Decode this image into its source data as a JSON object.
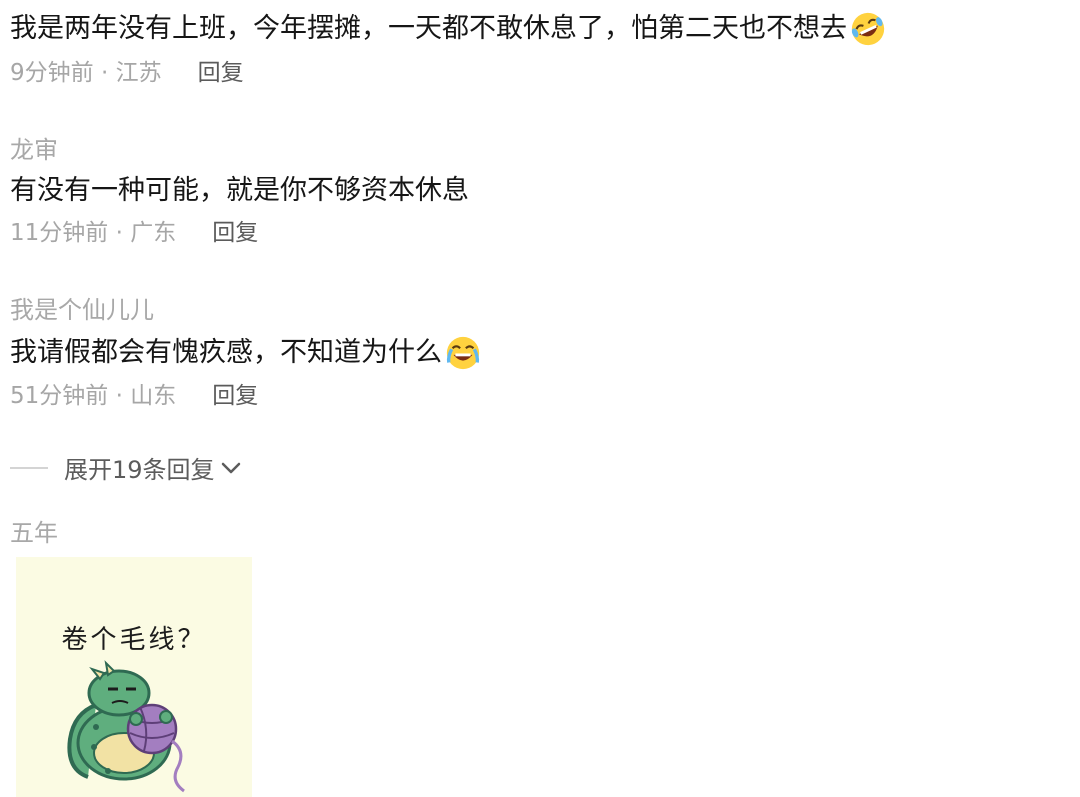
{
  "comments": [
    {
      "username": "",
      "text": "我是两年没有上班，今年摆摊，一天都不敢休息了，怕第二天也不想去",
      "emoji": "rofl-emoji",
      "meta": "9分钟前 · 江苏",
      "reply_label": "回复"
    },
    {
      "username": "龙审",
      "text": "有没有一种可能，就是你不够资本休息",
      "meta": "11分钟前 · 广东",
      "reply_label": "回复"
    },
    {
      "username": "我是个仙儿儿",
      "text": "我请假都会有愧疚感，不知道为什么",
      "emoji": "crying-laughing-emoji",
      "meta": "51分钟前 · 山东",
      "reply_label": "回复"
    }
  ],
  "expand_replies": {
    "label": "展开19条回复",
    "icon": "chevron-down-icon"
  },
  "last_comment": {
    "username": "五年",
    "sticker": {
      "caption": "卷个毛线？",
      "image": "dragon-with-yarn-sticker",
      "background": "#fbfbe3"
    }
  },
  "colors": {
    "text": "#161616",
    "meta": "#a6a6a6",
    "username": "#a8a8a8",
    "reply": "#5b5b5b",
    "emoji_yellow": "#ffd23f"
  }
}
